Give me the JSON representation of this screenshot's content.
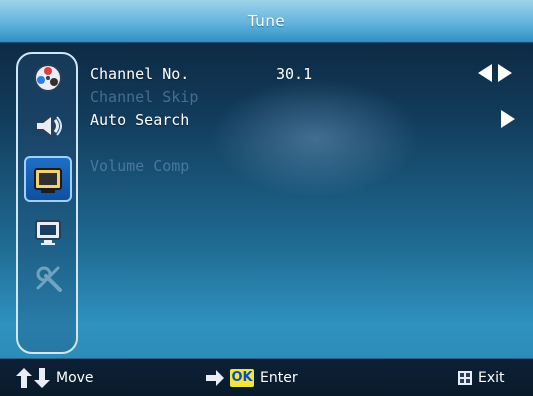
{
  "title": "Tune",
  "sidebar": {
    "items": [
      {
        "name": "color-wheel"
      },
      {
        "name": "sound"
      },
      {
        "name": "tv-tune",
        "selected": true
      },
      {
        "name": "picture"
      },
      {
        "name": "settings"
      }
    ]
  },
  "menu": {
    "items": [
      {
        "label": "Channel No.",
        "value": "30.1",
        "state": "active",
        "control": "left-right-icon"
      },
      {
        "label": "Channel Skip",
        "value": "",
        "state": "dim",
        "control": ""
      },
      {
        "label": "Auto Search",
        "value": "",
        "state": "active",
        "control": "right-icon"
      },
      {
        "label": "Volume Comp",
        "value": "",
        "state": "dim",
        "control": ""
      }
    ]
  },
  "footer": {
    "move_label": "Move",
    "ok_badge": "OK",
    "enter_label": "Enter",
    "exit_label": "Exit"
  },
  "colors": {
    "title_bar": "#62b4dc",
    "background": "#1f6b92",
    "selected_tile": "#1f6fc7",
    "ok_badge_bg": "#f2e63b"
  }
}
